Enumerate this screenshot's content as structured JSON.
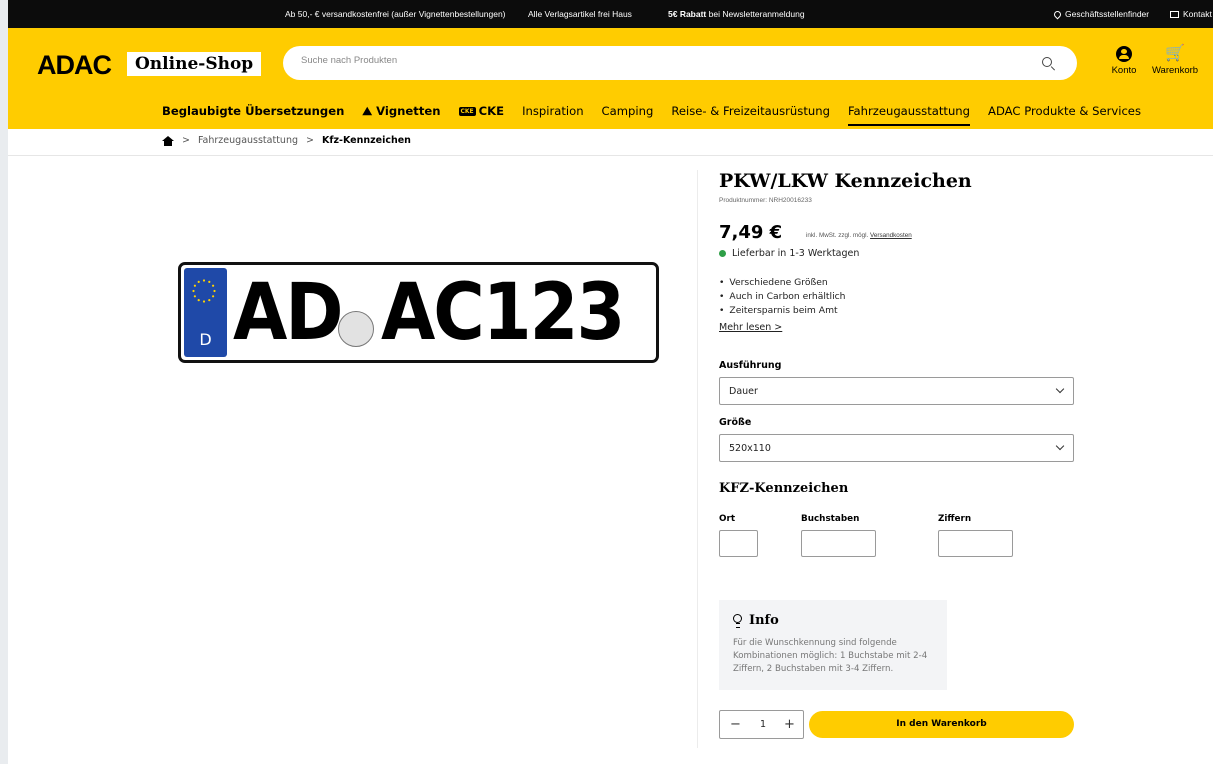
{
  "topbar": {
    "msg1": "Ab 50,- € versandkostenfrei (außer Vignettenbestellungen)",
    "msg2": "Alle Verlagsartikel frei Haus",
    "msg3_bold": "5€ Rabatt",
    "msg3_rest": " bei Newsletteranmeldung",
    "store_finder": "Geschäftsstellenfinder",
    "contact": "Kontakt"
  },
  "header": {
    "logo": "ADAC",
    "shop_label": "Online-Shop",
    "search_placeholder": "Suche nach Produkten",
    "account_label": "Konto",
    "cart_label": "Warenkorb"
  },
  "nav": {
    "items": [
      {
        "label": "Beglaubigte Übersetzungen"
      },
      {
        "label": "Vignetten"
      },
      {
        "label": "CKE",
        "badge": "CKE"
      },
      {
        "label": "Inspiration"
      },
      {
        "label": "Camping"
      },
      {
        "label": "Reise- & Freizeitausrüstung"
      },
      {
        "label": "Fahrzeugausstattung"
      },
      {
        "label": "ADAC Produkte & Services"
      }
    ]
  },
  "breadcrumb": {
    "items": [
      "Fahrzeugausstattung",
      "Kfz-Kennzeichen"
    ],
    "separator": ">"
  },
  "plate": {
    "country": "D",
    "text_left": "AD",
    "text_right": "AC123"
  },
  "product": {
    "title": "PKW/LKW Kennzeichen",
    "product_number": "Produktnummer: NRH20016233",
    "price": "7,49 €",
    "price_note": "inkl. MwSt. zzgl. mögl.",
    "shipping_link": "Versandkosten",
    "availability": "Lieferbar in 1-3 Werktagen",
    "availability_color": "#2e9f47",
    "features": [
      "Verschiedene Größen",
      "Auch in Carbon erhältlich",
      "Zeitersparnis beim Amt"
    ],
    "read_more": "Mehr lesen >"
  },
  "options": {
    "execution_label": "Ausführung",
    "execution_value": "Dauer",
    "size_label": "Größe",
    "size_value": "520x110"
  },
  "kfz": {
    "heading": "KFZ-Kennzeichen",
    "ort_label": "Ort",
    "letters_label": "Buchstaben",
    "digits_label": "Ziffern",
    "ort_value": "",
    "letters_value": "",
    "digits_value": ""
  },
  "info": {
    "title": "Info",
    "text": "Für die Wunschkennung sind folgende Kombinationen möglich: 1 Buchstabe mit 2-4 Ziffern, 2 Buchstaben mit 3-4 Ziffern."
  },
  "cart": {
    "quantity": "1",
    "minus": "−",
    "plus": "+",
    "button_label": "In den Warenkorb"
  },
  "colors": {
    "brand_yellow": "#ffcc00",
    "topbar": "#0c0c0c",
    "eu_blue": "#1f49a8"
  }
}
